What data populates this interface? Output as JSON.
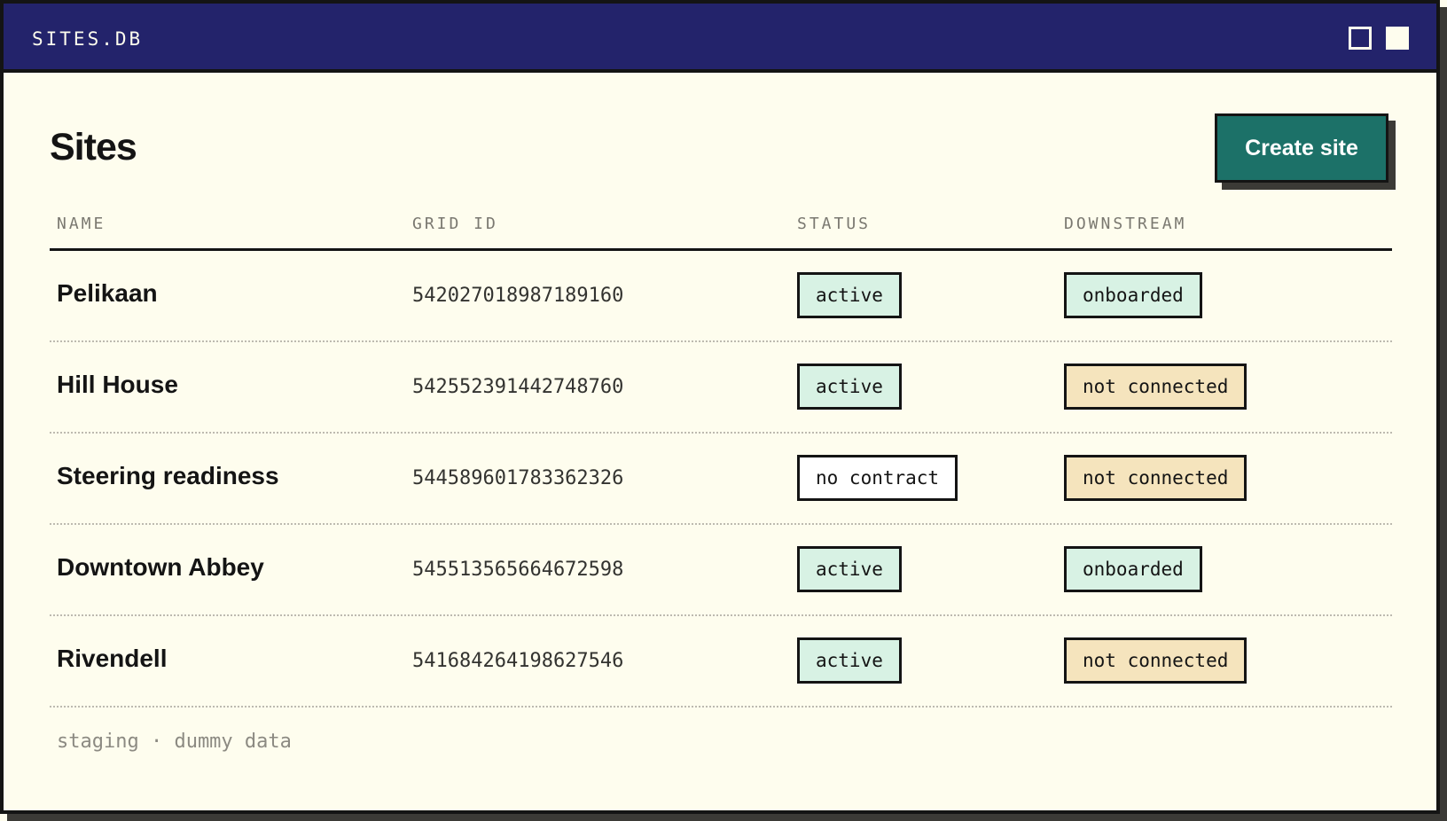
{
  "window": {
    "title": "SITES.DB"
  },
  "page": {
    "title": "Sites",
    "create_button": "Create site"
  },
  "table": {
    "headers": [
      "NAME",
      "GRID ID",
      "STATUS",
      "DOWNSTREAM"
    ],
    "rows": [
      {
        "name": "Pelikaan",
        "grid_id": "542027018987189160",
        "status": "active",
        "downstream": "onboarded"
      },
      {
        "name": "Hill House",
        "grid_id": "542552391442748760",
        "status": "active",
        "downstream": "not connected"
      },
      {
        "name": "Steering readiness",
        "grid_id": "544589601783362326",
        "status": "no contract",
        "downstream": "not connected"
      },
      {
        "name": "Downtown Abbey",
        "grid_id": "545513565664672598",
        "status": "active",
        "downstream": "onboarded"
      },
      {
        "name": "Rivendell",
        "grid_id": "541684264198627546",
        "status": "active",
        "downstream": "not connected"
      }
    ]
  },
  "footer": {
    "note": "staging · dummy data"
  },
  "colors": {
    "titlebar": "#23236b",
    "accent_button": "#1c7168",
    "badge_active": "#d8f2e4",
    "badge_onboarded": "#d8f2e4",
    "badge_not_connected": "#f5e4bd",
    "badge_no_contract": "#ffffff"
  },
  "icons": {
    "window_controls": [
      "square-outline-icon",
      "square-filled-icon"
    ]
  }
}
